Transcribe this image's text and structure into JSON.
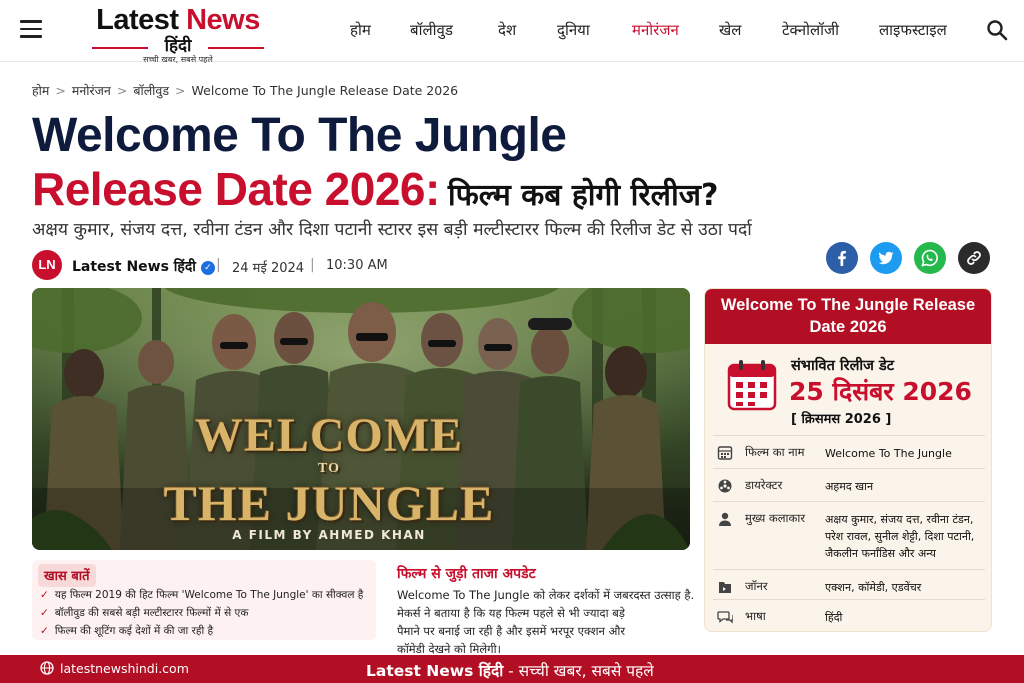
{
  "header": {
    "logo": {
      "latest": "Latest",
      "news": "News",
      "hindi": "हिंदी",
      "tagline": "सच्ची खबर, सबसे पहले"
    },
    "nav": [
      "होम",
      "बॉलीवुड",
      "देश",
      "दुनिया",
      "मनोरंजन",
      "खेल",
      "टेक्नोलॉजी",
      "लाइफस्टाइल"
    ],
    "active_nav": "मनोरंजन"
  },
  "breadcrumb": {
    "items": [
      "होम",
      "मनोरंजन",
      "बॉलीवुड"
    ],
    "current": "Welcome To The Jungle Release Date 2026"
  },
  "article": {
    "title_line1": "Welcome To The Jungle",
    "title_line2_red": "Release Date 2026:",
    "title_line2_hindi": "फिल्म कब होगी रिलीज?",
    "subtitle": "अक्षय कुमार, संजय दत्त, रवीना टंडन और दिशा पटानी स्टारर इस बड़ी मल्टीस्टारर फिल्म की रिलीज डेट से उठा पर्दा",
    "author_initials": "LN",
    "author": "Latest News हिंदी",
    "date": "24 मई 2024",
    "time": "10:30 AM"
  },
  "share": [
    {
      "name": "facebook",
      "color": "#2d5fa8"
    },
    {
      "name": "twitter",
      "color": "#1d9bf0"
    },
    {
      "name": "whatsapp",
      "color": "#25b84d"
    },
    {
      "name": "link",
      "color": "#2b2b2b"
    }
  ],
  "hero": {
    "title_top": "WELCOME",
    "title_mid": "TO",
    "title_bottom": "THE JUNGLE",
    "credit": "A FILM BY AHMED KHAN"
  },
  "card": {
    "heading": "Welcome To The Jungle Release Date 2026",
    "release_label": "संभावित रिलीज डेट",
    "release_date": "25 दिसंबर 2026",
    "release_note": "[ क्रिसमस 2026 ]",
    "rows": [
      {
        "icon": "film-icon",
        "key": "फिल्म का नाम",
        "value": "Welcome To The Jungle"
      },
      {
        "icon": "director-icon",
        "key": "डायरेक्टर",
        "value": "अहमद खान"
      },
      {
        "icon": "cast-icon",
        "key": "मुख्य कलाकार",
        "value": "अक्षय कुमार, संजय दत्त, रवीना टंडन, परेश रावल, सुनील शेट्टी, दिशा पटानी, जैकलीन फर्नांडिस और अन्य"
      },
      {
        "icon": "genre-icon",
        "key": "जॉनर",
        "value": "एक्शन, कॉमेडी, एडवेंचर"
      },
      {
        "icon": "language-icon",
        "key": "भाषा",
        "value": "हिंदी"
      }
    ]
  },
  "highlights": {
    "heading": "खास बातें",
    "items": [
      "यह फिल्म 2019 की हिट फिल्म 'Welcome To The Jungle' का सीक्वल है",
      "बॉलीवुड की सबसे बड़ी मल्टीस्टारर फिल्मों में से एक",
      "फिल्म की शूटिंग कई देशों में की जा रही है"
    ]
  },
  "update": {
    "heading": "फिल्म से जुड़ी ताजा अपडेट",
    "lines": [
      "Welcome To The Jungle को लेकर दर्शकों में जबरदस्त उत्साह है.",
      "मेकर्स ने बताया है कि यह फिल्म पहले से भी ज्यादा बड़े",
      "पैमाने पर बनाई जा रही है और इसमें भरपूर एक्शन और",
      "कॉमेडी देखने को मिलेगी।"
    ]
  },
  "footer": {
    "site": "latestnewshindi.com",
    "brand": "Latest News हिंदी",
    "tagline": " - सच्ची खबर, सबसे पहले"
  }
}
